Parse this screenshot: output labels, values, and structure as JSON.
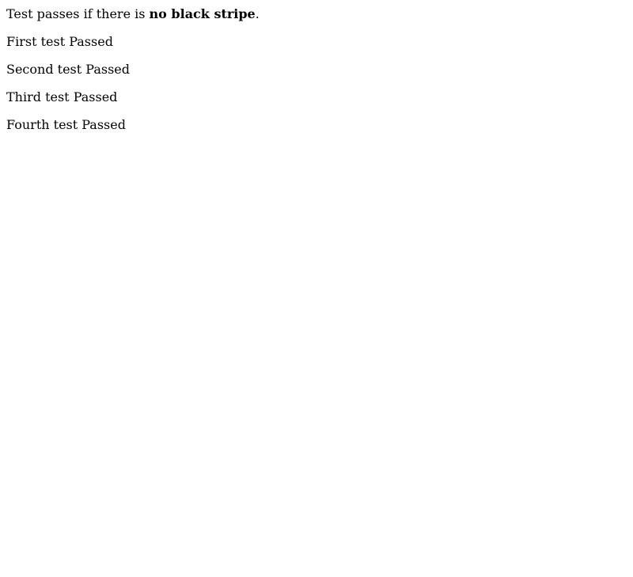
{
  "intro": {
    "prefix": "Test passes if there is ",
    "emphasis": "no black stripe",
    "suffix": "."
  },
  "results": [
    "First test Passed",
    "Second test Passed",
    "Third test Passed",
    "Fourth test Passed"
  ]
}
